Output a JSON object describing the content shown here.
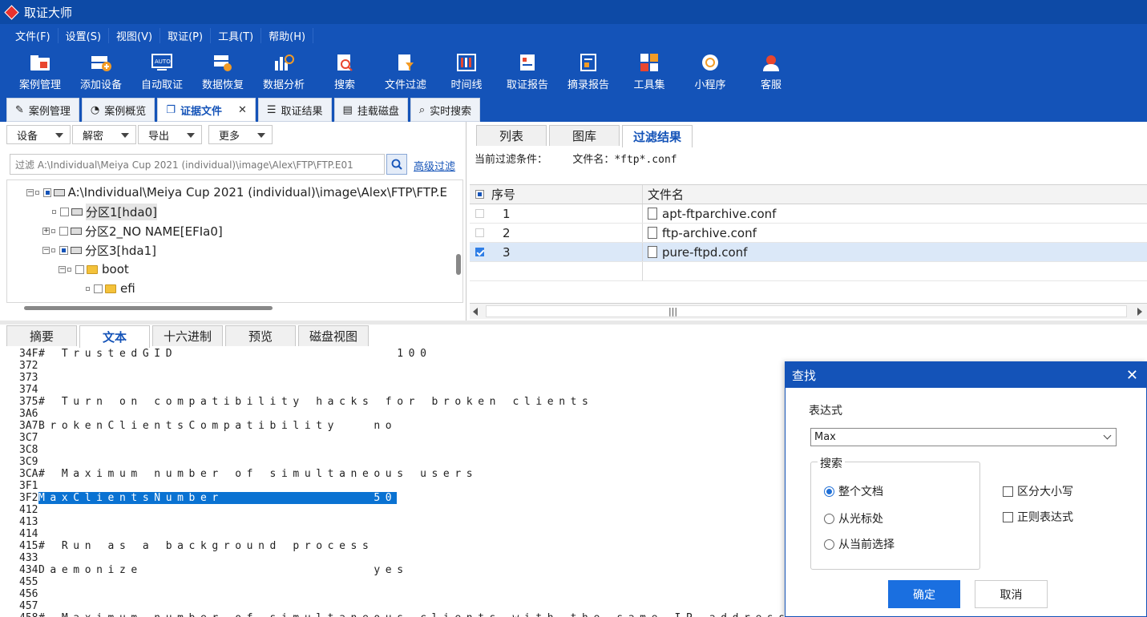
{
  "app": {
    "title": "取证大师"
  },
  "menu": [
    "文件(F)",
    "设置(S)",
    "视图(V)",
    "取证(P)",
    "工具(T)",
    "帮助(H)"
  ],
  "toolbar": [
    {
      "label": "案例管理",
      "icon": "case-management-icon"
    },
    {
      "label": "添加设备",
      "icon": "add-device-icon"
    },
    {
      "label": "自动取证",
      "icon": "auto-forensics-icon"
    },
    {
      "label": "数据恢复",
      "icon": "data-recovery-icon"
    },
    {
      "label": "数据分析",
      "icon": "data-analysis-icon"
    },
    {
      "label": "搜索",
      "icon": "search-icon"
    },
    {
      "label": "文件过滤",
      "icon": "file-filter-icon"
    },
    {
      "label": "时间线",
      "icon": "timeline-icon"
    },
    {
      "label": "取证报告",
      "icon": "forensic-report-icon"
    },
    {
      "label": "摘录报告",
      "icon": "excerpt-report-icon"
    },
    {
      "label": "工具集",
      "icon": "toolset-icon"
    },
    {
      "label": "小程序",
      "icon": "mini-program-icon"
    },
    {
      "label": "客服",
      "icon": "customer-service-icon"
    }
  ],
  "tabs": [
    {
      "label": "案例管理"
    },
    {
      "label": "案例概览"
    },
    {
      "label": "证据文件",
      "close": "✕"
    },
    {
      "label": "取证结果"
    },
    {
      "label": "挂载磁盘"
    },
    {
      "label": "实时搜索"
    }
  ],
  "left": {
    "dropdowns": [
      "设备",
      "解密",
      "导出",
      "更多"
    ],
    "filter_placeholder": "过滤 A:\\Individual\\Meiya Cup 2021 (individual)\\image\\Alex\\FTP\\FTP.E01",
    "advanced_filter": "高级过滤",
    "tree": [
      {
        "label": "A:\\Individual\\Meiya Cup 2021 (individual)\\image\\Alex\\FTP\\FTP.E",
        "exp": "−"
      },
      {
        "label": "分区1[hda0]",
        "exp": ""
      },
      {
        "label": "分区2_NO NAME[EFIa0]",
        "exp": "+"
      },
      {
        "label": "分区3[hda1]",
        "exp": "−"
      },
      {
        "label": "boot",
        "exp": "−"
      },
      {
        "label": "efi",
        "exp": ""
      }
    ]
  },
  "right": {
    "tabs": [
      "列表",
      "图库",
      "过滤结果"
    ],
    "condition_label": "当前过滤条件：",
    "condition_value": "文件名：*ftp*.conf",
    "columns": [
      "序号",
      "文件名"
    ],
    "rows": [
      {
        "no": "1",
        "name": "apt-ftparchive.conf",
        "checked": false
      },
      {
        "no": "2",
        "name": "ftp-archive.conf",
        "checked": false
      },
      {
        "no": "3",
        "name": "pure-ftpd.conf",
        "checked": true
      }
    ],
    "scroll_grip": "|||"
  },
  "bottom": {
    "tabs": [
      "摘要",
      "文本",
      "十六进制",
      "预览",
      "磁盘视图"
    ],
    "lines": [
      {
        "off": "34F",
        "text": "# TrustedGID                   100"
      },
      {
        "off": "372",
        "text": ""
      },
      {
        "off": "373",
        "text": ""
      },
      {
        "off": "374",
        "text": ""
      },
      {
        "off": "375",
        "text": "# Turn on compatibility hacks for broken clients"
      },
      {
        "off": "3A6",
        "text": ""
      },
      {
        "off": "3A7",
        "text": "BrokenClientsCompatibility   no"
      },
      {
        "off": "3C7",
        "text": ""
      },
      {
        "off": "3C8",
        "text": ""
      },
      {
        "off": "3C9",
        "text": ""
      },
      {
        "off": "3CA",
        "text": "# Maximum number of simultaneous users"
      },
      {
        "off": "3F1",
        "text": ""
      },
      {
        "off": "3F2",
        "text": "MaxClientsNumber             50",
        "highlight": true
      },
      {
        "off": "412",
        "text": ""
      },
      {
        "off": "413",
        "text": ""
      },
      {
        "off": "414",
        "text": ""
      },
      {
        "off": "415",
        "text": "# Run as a background process"
      },
      {
        "off": "433",
        "text": ""
      },
      {
        "off": "434",
        "text": "Daemonize                    yes"
      },
      {
        "off": "455",
        "text": ""
      },
      {
        "off": "456",
        "text": ""
      },
      {
        "off": "457",
        "text": ""
      },
      {
        "off": "458",
        "text": "# Maximum number of simultaneous clients with the same IP address"
      }
    ]
  },
  "find": {
    "title": "查找",
    "close": "✕",
    "expr_label": "表达式",
    "expr_value": "Max",
    "search_group": "搜索",
    "opt_whole": "整个文档",
    "opt_cursor": "从光标处",
    "opt_selection": "从当前选择",
    "case": "区分大小写",
    "regex": "正则表达式",
    "ok": "确定",
    "cancel": "取消"
  },
  "colors": {
    "brand": "#1453b8",
    "highlight": "#0a72d2",
    "ok": "#1a6fe0"
  }
}
